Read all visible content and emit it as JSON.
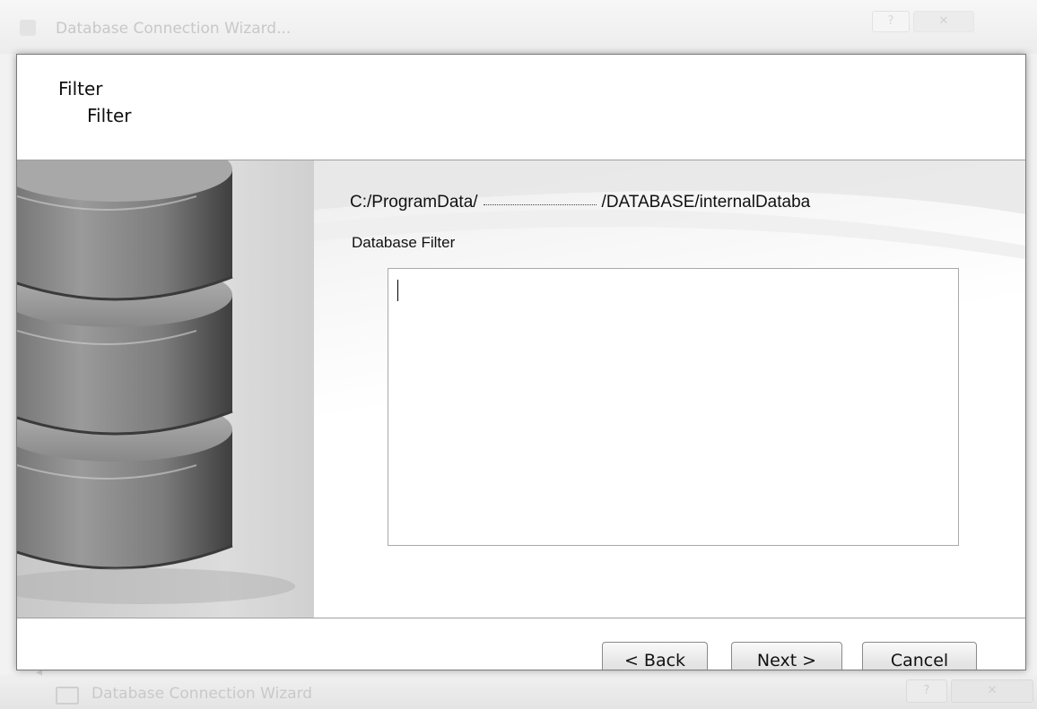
{
  "ghost_window": {
    "title": "Database Connection Wizard...",
    "bottom_title": "Database Connection Wizard"
  },
  "header": {
    "title": "Filter",
    "subtitle": "Filter"
  },
  "content": {
    "path_prefix": "C:/ProgramData/",
    "path_suffix": "/DATABASE/internalDataba",
    "filter_label": "Database Filter",
    "filter_value": ""
  },
  "buttons": {
    "back": "< Back",
    "next": "Next >",
    "cancel": "Cancel"
  },
  "icons": {
    "help": "help-icon",
    "close": "close-icon",
    "database": "database-icon"
  }
}
